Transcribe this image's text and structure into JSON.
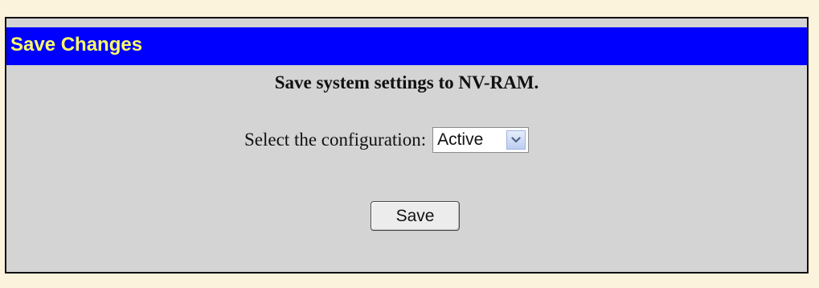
{
  "panel": {
    "title": "Save Changes",
    "heading": "Save system settings to NV-RAM.",
    "config": {
      "label": "Select the configuration:",
      "selected_value": "Active"
    },
    "save_label": "Save"
  },
  "icons": {
    "dropdown": "chevron-down-icon"
  },
  "colors": {
    "title_bar": "#0000ff",
    "title_text": "#ffff66",
    "panel_background": "#d4d4d4",
    "page_background": "#fbf3dc"
  }
}
